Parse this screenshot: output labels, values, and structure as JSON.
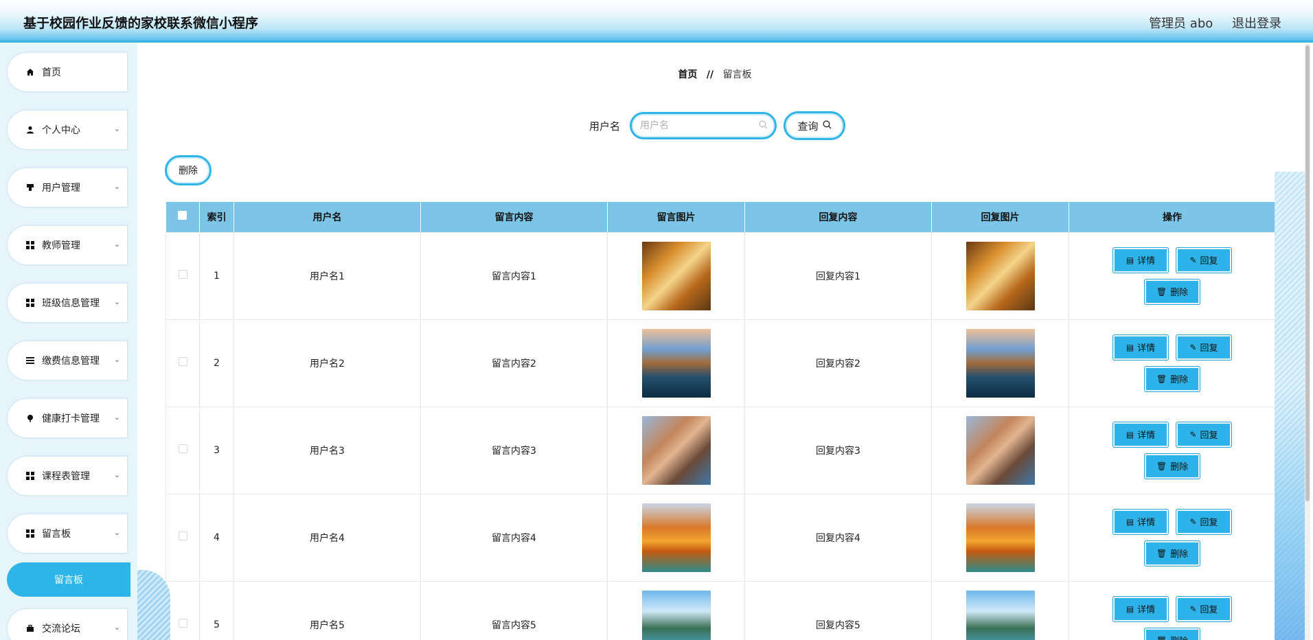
{
  "header": {
    "title": "基于校园作业反馈的家校联系微信小程序",
    "user": "管理员 abo",
    "logout": "退出登录"
  },
  "sidebar": {
    "items": [
      {
        "label": "首页",
        "icon": "home-icon"
      },
      {
        "label": "个人中心",
        "icon": "person-icon"
      },
      {
        "label": "用户管理",
        "icon": "user-mgmt-icon"
      },
      {
        "label": "教师管理",
        "icon": "grid-icon"
      },
      {
        "label": "班级信息管理",
        "icon": "grid-icon"
      },
      {
        "label": "缴费信息管理",
        "icon": "list-icon"
      },
      {
        "label": "健康打卡管理",
        "icon": "pin-icon"
      },
      {
        "label": "课程表管理",
        "icon": "grid-icon"
      },
      {
        "label": "留言板",
        "icon": "grid-icon"
      },
      {
        "label": "交流论坛",
        "icon": "briefcase-icon"
      }
    ],
    "active_sub": "留言板"
  },
  "breadcrumb": {
    "home": "首页",
    "separator": "//",
    "current": "留言板"
  },
  "search": {
    "label": "用户名",
    "placeholder": "用户名",
    "query_button": "查询"
  },
  "toolbar": {
    "delete_label": "删除"
  },
  "table": {
    "columns": [
      "",
      "索引",
      "用户名",
      "留言内容",
      "留言图片",
      "回复内容",
      "回复图片",
      "操作"
    ],
    "rows": [
      {
        "index": "1",
        "username": "用户名1",
        "content": "留言内容1",
        "image": "autumn-forest-image",
        "reply": "回复内容1",
        "reply_image": "autumn-forest-image"
      },
      {
        "index": "2",
        "username": "用户名2",
        "content": "留言内容2",
        "image": "lake-castle-image",
        "reply": "回复内容2",
        "reply_image": "lake-castle-image"
      },
      {
        "index": "3",
        "username": "用户名3",
        "content": "留言内容3",
        "image": "coastal-village-image",
        "reply": "回复内容3",
        "reply_image": "coastal-village-image"
      },
      {
        "index": "4",
        "username": "用户名4",
        "content": "留言内容4",
        "image": "autumn-bridge-image",
        "reply": "回复内容4",
        "reply_image": "autumn-bridge-image"
      },
      {
        "index": "5",
        "username": "用户名5",
        "content": "留言内容5",
        "image": "mountain-river-image",
        "reply": "回复内容5",
        "reply_image": "mountain-river-image"
      }
    ],
    "actions": {
      "detail": "详情",
      "reply": "回复",
      "delete": "删除"
    }
  },
  "colors": {
    "accent": "#2db3ea",
    "table_header": "#7cc5e6",
    "sidebar_bg": "#e6f4fb"
  }
}
